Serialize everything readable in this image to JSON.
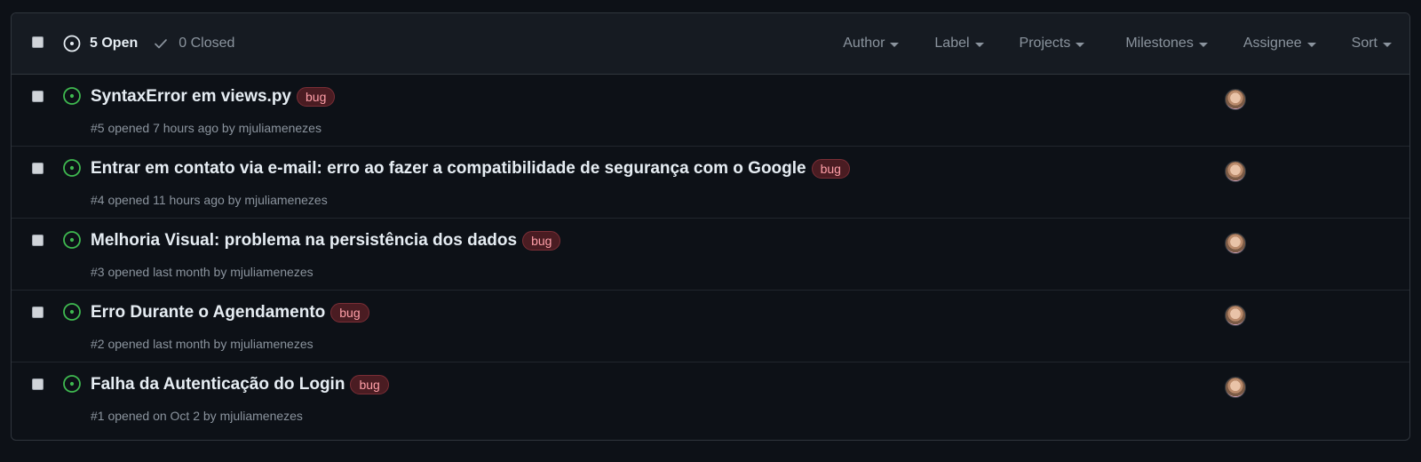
{
  "header": {
    "open_label": "5 Open",
    "closed_label": "0 Closed",
    "filters": [
      "Author",
      "Label",
      "Projects",
      "Milestones",
      "Assignee",
      "Sort"
    ]
  },
  "issues": [
    {
      "title": "SyntaxError em views.py",
      "label": "bug",
      "number": "#5",
      "opened_text": "opened 7 hours ago by",
      "author": "mjuliamenezes"
    },
    {
      "title": "Entrar em contato via e-mail: erro ao fazer a compatibilidade de segurança com o Google",
      "label": "bug",
      "number": "#4",
      "opened_text": "opened 11 hours ago by",
      "author": "mjuliamenezes"
    },
    {
      "title": "Melhoria Visual: problema na persistência dos dados",
      "label": "bug",
      "number": "#3",
      "opened_text": "opened last month by",
      "author": "mjuliamenezes"
    },
    {
      "title": "Erro Durante o Agendamento",
      "label": "bug",
      "number": "#2",
      "opened_text": "opened last month by",
      "author": "mjuliamenezes"
    },
    {
      "title": "Falha da Autenticação do Login",
      "label": "bug",
      "number": "#1",
      "opened_text": "opened on Oct 2 by",
      "author": "mjuliamenezes"
    }
  ],
  "colors": {
    "background": "#0d1117",
    "header_bg": "#161b22",
    "open_green": "#3fb950",
    "label_bug_text": "#ff9fa8",
    "label_bug_bg": "#4a1c22",
    "muted": "#8b949e"
  },
  "icons": {
    "open_issue": "issue-opened-icon",
    "closed_check": "check-icon",
    "dropdown": "caret-down-icon"
  }
}
